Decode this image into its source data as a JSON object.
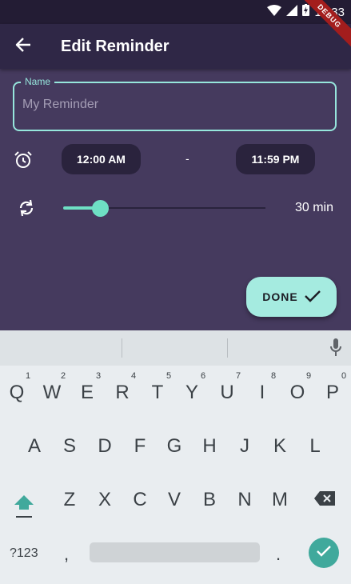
{
  "status_bar": {
    "time": "10:33",
    "debug_label": "DEBUG"
  },
  "app_bar": {
    "title": "Edit Reminder"
  },
  "form": {
    "name_label": "Name",
    "name_placeholder": "My Reminder",
    "name_value": "",
    "start_time": "12:00 AM",
    "time_separator": "-",
    "end_time": "11:59 PM",
    "interval_value": "30 min",
    "interval_fraction": 0.18
  },
  "done_button": {
    "label": "DONE"
  },
  "colors": {
    "accent": "#6ee0c4",
    "background": "#453a5e",
    "app_bar": "#2f2746",
    "done": "#a5ebe0",
    "enter": "#40a99c"
  },
  "keyboard": {
    "row1": [
      "Q",
      "W",
      "E",
      "R",
      "T",
      "Y",
      "U",
      "I",
      "O",
      "P"
    ],
    "row1_hints": [
      "1",
      "2",
      "3",
      "4",
      "5",
      "6",
      "7",
      "8",
      "9",
      "0"
    ],
    "row2": [
      "A",
      "S",
      "D",
      "F",
      "G",
      "H",
      "J",
      "K",
      "L"
    ],
    "row3": [
      "Z",
      "X",
      "C",
      "V",
      "B",
      "N",
      "M"
    ],
    "symbols_label": "?123",
    "comma_label": ",",
    "period_label": "."
  }
}
